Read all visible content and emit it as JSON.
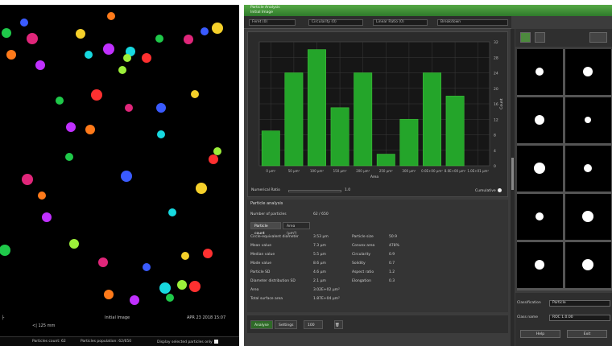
{
  "viewer": {
    "scale_label": "<| 125 mm",
    "image_label": "Initial Image",
    "date_label": "APR 23 2018 15:07",
    "footer_count": "Particles count: 62",
    "footer_pop": "Particles population: 62/650",
    "footer_toggle": "Display selected particles only",
    "particle_colors": [
      "#1fc94a",
      "#e0267a",
      "#3a5bff",
      "#f5d02a",
      "#ff7a1a",
      "#c030ff",
      "#17d9e0",
      "#9cef3a",
      "#ff3030"
    ]
  },
  "app": {
    "title": "Particle Analysis",
    "subtitle": "Initial Image",
    "toolbar": {
      "field1": "Feret (0)",
      "field2": "Circularity (0)",
      "field3": "Linear Ratio (0)",
      "field4": "Breakdown"
    },
    "chart_data": {
      "type": "bar",
      "categories": [
        "0 µm²",
        "50 µm²",
        "100 µm²",
        "150 µm²",
        "200 µm²",
        "250 µm²",
        "300 µm²",
        "0.0E+00 µm²",
        "8.0E+00 µm²",
        "1.0E+01 µm²"
      ],
      "values": [
        9,
        24,
        30,
        15,
        24,
        3,
        12,
        24,
        18,
        0
      ],
      "ylim": [
        0,
        32
      ],
      "xlabel": "Area",
      "ylabel": "Count",
      "y_ticks": [
        "0",
        "4",
        "8",
        "12",
        "16",
        "20",
        "24",
        "28",
        "32"
      ],
      "bar_color": "#24a52a",
      "bar_color_light": "#3ec23a",
      "grid": true
    },
    "ratio_label": "Numerical Ratio",
    "ratio_value": "1.0",
    "cumulative_label": "Cumulative",
    "stats": {
      "title": "Particle analysis",
      "count_label": "Number of particles",
      "count_value": "62 / 650",
      "tabs": [
        "Particle count",
        "Area (µm²)"
      ],
      "rows": [
        {
          "k": "Circle-equivalent diameter",
          "v": "3.53 µm",
          "k2": "Particle size",
          "v2": "50.9"
        },
        {
          "k": "Mean value",
          "v": "7.3 µm",
          "k2": "Convex area",
          "v2": "478%"
        },
        {
          "k": "Median value",
          "v": "5.5 µm",
          "k2": "Circularity",
          "v2": "0.9"
        },
        {
          "k": "Mode value",
          "v": "8.6 µm",
          "k2": "Solidity",
          "v2": "0.7"
        },
        {
          "k": "Particle SD",
          "v": "4.6 µm",
          "k2": "Aspect ratio",
          "v2": "1.2"
        },
        {
          "k": "Diameter distribution SD",
          "v": "2.1 µm",
          "k2": "Elongation",
          "v2": "0.3"
        },
        {
          "k": "Area",
          "v": "3.02E+02 µm²",
          "k2": "",
          "v2": ""
        },
        {
          "k": "Total surface area",
          "v": "1.87E+04 µm²",
          "k2": "",
          "v2": ""
        }
      ]
    },
    "bottom": {
      "btn_analyse": "Analyse",
      "btn_settings": "Settings",
      "zoom": "100"
    },
    "right": {
      "label_a": "Classification",
      "value_a": "Particle",
      "label_b": "Class name",
      "value_b": "ROC 1.0.00",
      "btn_left": "Help",
      "btn_right": "Exit"
    }
  }
}
